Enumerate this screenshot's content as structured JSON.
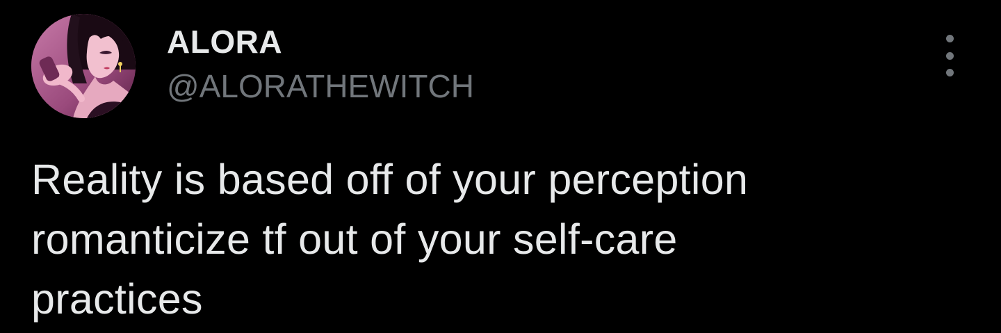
{
  "author": {
    "display_name": "ALORA",
    "handle": "@ALORATHEWITCH",
    "avatar_icon": "anime-girl-avatar"
  },
  "menu": {
    "icon": "more-vertical-icon"
  },
  "tweet": {
    "lines": [
      "Reality is based off of your perception",
      "romanticize tf out of your self-care",
      "practices"
    ]
  },
  "colors": {
    "background": "#000000",
    "primary_text": "#e7e9ea",
    "secondary_text": "#71767b"
  }
}
